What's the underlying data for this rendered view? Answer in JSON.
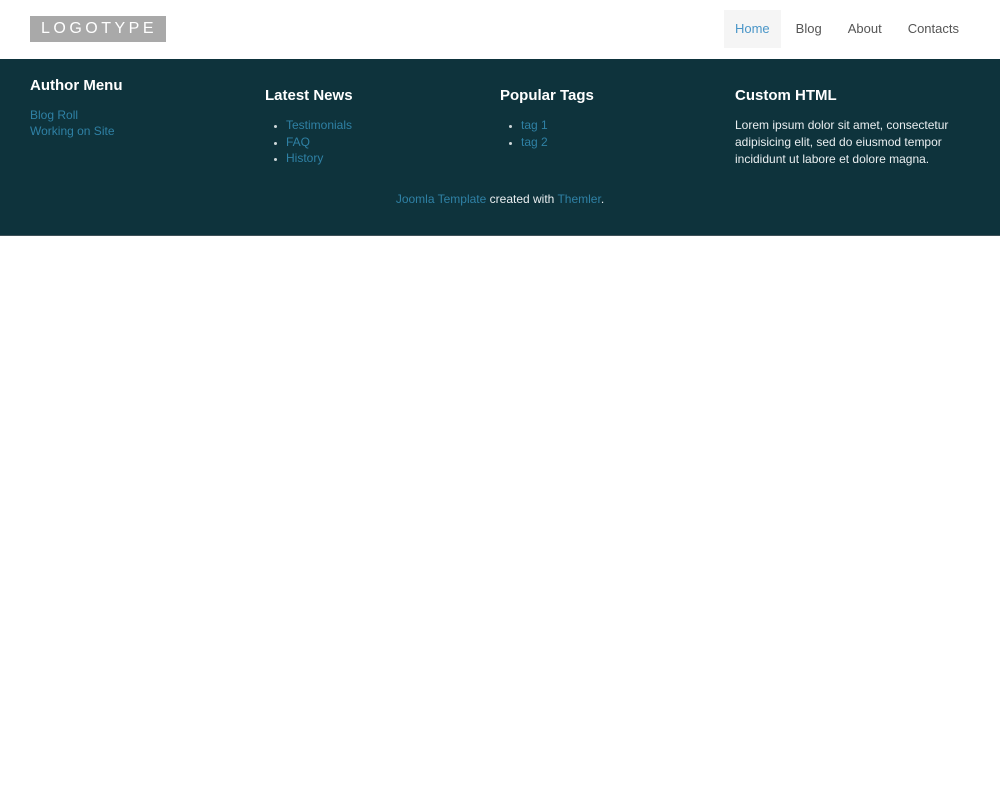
{
  "header": {
    "logo": "LOGOTYPE",
    "nav": [
      {
        "label": "Home",
        "active": true
      },
      {
        "label": "Blog",
        "active": false
      },
      {
        "label": "About",
        "active": false
      },
      {
        "label": "Contacts",
        "active": false
      }
    ]
  },
  "footer": {
    "columns": [
      {
        "title": "Author Menu",
        "type": "plain-links",
        "links": [
          "Blog Roll",
          "Working on Site"
        ]
      },
      {
        "title": "Latest News",
        "type": "bullet-links",
        "links": [
          "Testimonials",
          "FAQ",
          "History"
        ]
      },
      {
        "title": "Popular Tags",
        "type": "bullet-links",
        "links": [
          "tag 1",
          "tag 2"
        ]
      },
      {
        "title": "Custom HTML",
        "type": "text",
        "text": "Lorem ipsum dolor sit amet, consectetur adipisicing elit, sed do eiusmod tempor incididunt ut labore et dolore magna."
      }
    ],
    "credit": {
      "link1": "Joomla Template",
      "middle": " created with ",
      "link2": "Themler",
      "suffix": "."
    }
  },
  "colors": {
    "footer_background": "#0e333c",
    "footer_link": "#2f81a5",
    "footer_text": "#e9eef0",
    "nav_active_color": "#4a96c8",
    "nav_active_background": "#f5f5f5",
    "nav_color": "#555555",
    "logo_background": "#a9a9a9"
  }
}
